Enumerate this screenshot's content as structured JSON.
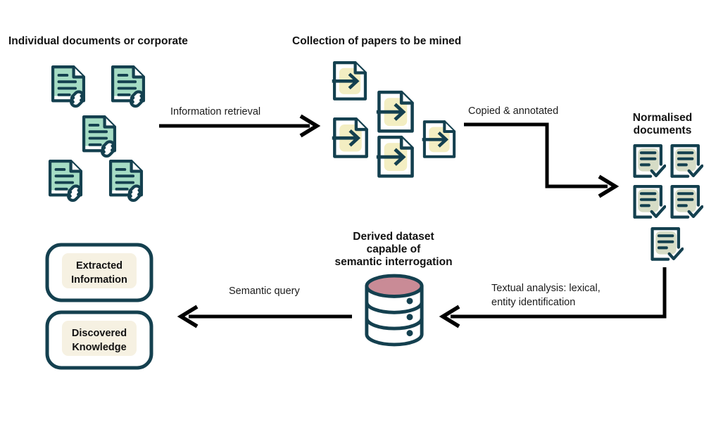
{
  "diagram": {
    "title_texts": {
      "individual_docs": "Individual documents or corporate",
      "collection": "Collection of papers to be mined",
      "normalised_line1": "Normalised",
      "normalised_line2": "documents",
      "derived_line1": "Derived dataset",
      "derived_line2": "capable of",
      "derived_line3": "semantic interrogation"
    },
    "arrow_labels": {
      "information_retrieval": "Information retrieval",
      "copied_annotated": "Copied & annotated",
      "textual_analysis_line1": "Textual analysis: lexical,",
      "textual_analysis_line2": "entity identification",
      "semantic_query": "Semantic query"
    },
    "outcome_boxes": [
      {
        "line1": "Extracted",
        "line2": "Information"
      },
      {
        "line1": "Discovered",
        "line2": "Knowledge"
      }
    ],
    "colors": {
      "ink": "#14404f",
      "doc_green": "#a5dcc4",
      "doc_yellow": "#f3eec2",
      "doc_grey_green": "#d6dcc6",
      "db_top": "#c98b96",
      "highlight_cream": "#f6f1e2",
      "arrow_black": "#000000",
      "background": "#ffffff"
    },
    "groups": {
      "individual_documents": {
        "icon": "document-link-icon",
        "count": 5,
        "fill": "#a5dcc4"
      },
      "collection_papers": {
        "icon": "document-import-arrow-icon",
        "count": 5,
        "fill": "#f3eec2"
      },
      "normalised_documents": {
        "icon": "document-check-icon",
        "count": 5,
        "fill": "#d6dcc6"
      },
      "derived_dataset": {
        "icon": "database-cylinder-icon",
        "tiers": 3
      }
    }
  }
}
